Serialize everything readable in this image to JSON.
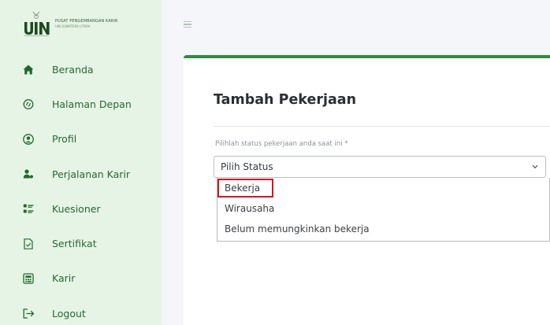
{
  "brand": {
    "line1": "PUSAT PENGEMBANGAN KARIR",
    "line2": "UIN SUMATERA UTARA"
  },
  "sidebar": {
    "items": [
      {
        "label": "Beranda",
        "icon": "home-icon"
      },
      {
        "label": "Halaman Depan",
        "icon": "link-icon"
      },
      {
        "label": "Profil",
        "icon": "user-circle-icon"
      },
      {
        "label": "Perjalanan Karir",
        "icon": "user-tie-icon"
      },
      {
        "label": "Kuesioner",
        "icon": "list-check-icon"
      },
      {
        "label": "Sertifikat",
        "icon": "certificate-icon"
      },
      {
        "label": "Karir",
        "icon": "briefcase-icon"
      },
      {
        "label": "Logout",
        "icon": "logout-icon"
      }
    ]
  },
  "page": {
    "title": "Tambah Pekerjaan",
    "field_label": "Pilihlah status pekerjaan anda saat ini *",
    "select_value": "Pilih Status",
    "options": [
      {
        "label": "Bekerja",
        "highlighted": true
      },
      {
        "label": "Wirausaha",
        "highlighted": false
      },
      {
        "label": "Belum memungkinkan bekerja",
        "highlighted": false
      }
    ]
  },
  "colors": {
    "accent": "#2e8b3e",
    "sidebar_bg": "#e6f4e6",
    "highlight": "#d3161b"
  }
}
